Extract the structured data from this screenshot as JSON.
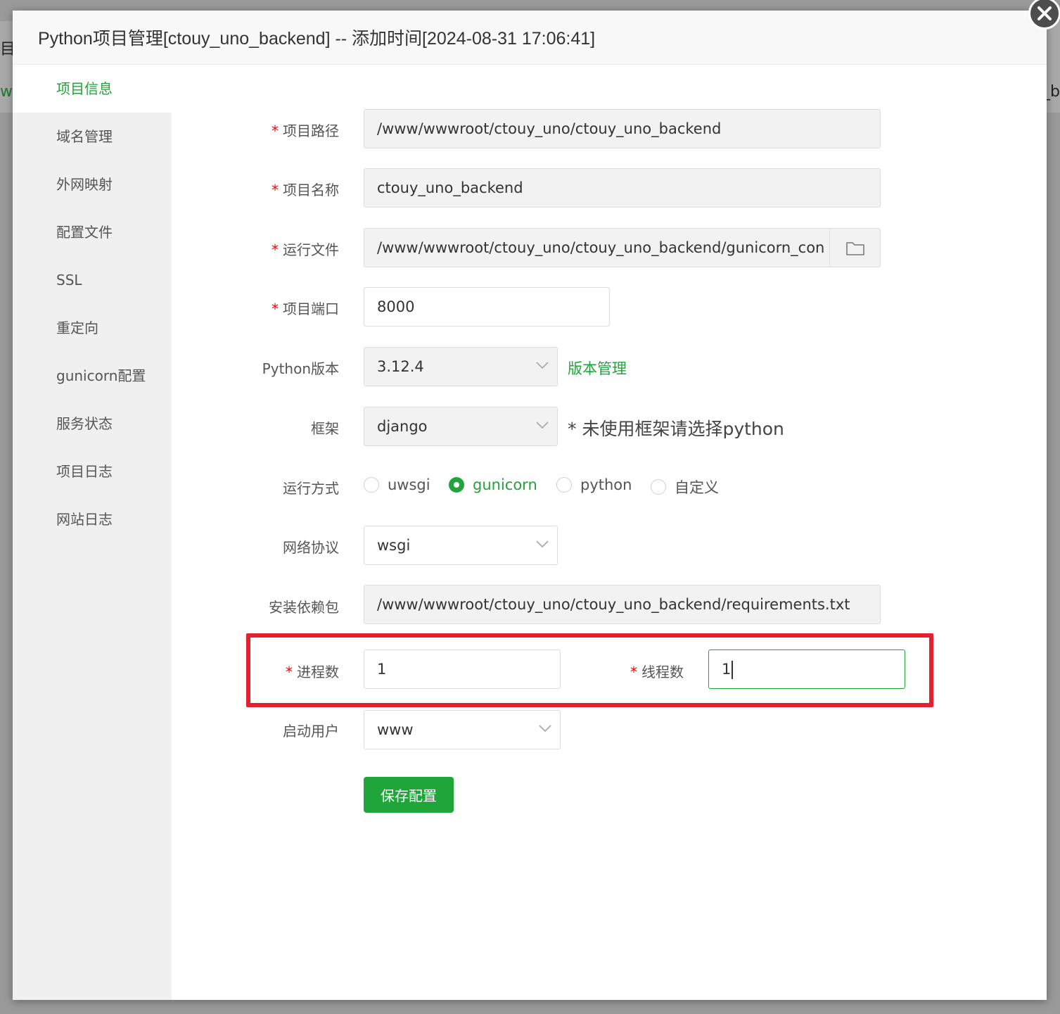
{
  "background": {
    "left_glyph": "目",
    "left_glyph2": "w",
    "right_glyph": "o_b"
  },
  "modal": {
    "title": "Python项目管理[ctouy_uno_backend] -- 添加时间[2024-08-31 17:06:41]"
  },
  "sidebar": {
    "items": [
      {
        "label": "项目信息",
        "active": true
      },
      {
        "label": "域名管理"
      },
      {
        "label": "外网映射"
      },
      {
        "label": "配置文件"
      },
      {
        "label": "SSL"
      },
      {
        "label": "重定向"
      },
      {
        "label": "gunicorn配置"
      },
      {
        "label": "服务状态"
      },
      {
        "label": "项目日志"
      },
      {
        "label": "网站日志"
      }
    ]
  },
  "form": {
    "required_mark": "*",
    "project_path": {
      "label": "项目路径",
      "value": "/www/wwwroot/ctouy_uno/ctouy_uno_backend"
    },
    "project_name": {
      "label": "项目名称",
      "value": "ctouy_uno_backend"
    },
    "run_file": {
      "label": "运行文件",
      "value": "/www/wwwroot/ctouy_uno/ctouy_uno_backend/gunicorn_con"
    },
    "project_port": {
      "label": "项目端口",
      "value": "8000"
    },
    "python_version": {
      "label": "Python版本",
      "value": "3.12.4",
      "link": "版本管理"
    },
    "framework": {
      "label": "框架",
      "value": "django",
      "hint": "* 未使用框架请选择python"
    },
    "run_mode": {
      "label": "运行方式",
      "options": [
        "uwsgi",
        "gunicorn",
        "python",
        "自定义"
      ],
      "selected": "gunicorn"
    },
    "network_protocol": {
      "label": "网络协议",
      "value": "wsgi"
    },
    "requirements": {
      "label": "安装依赖包",
      "value": "/www/wwwroot/ctouy_uno/ctouy_uno_backend/requirements.txt"
    },
    "processes": {
      "label": "进程数",
      "value": "1"
    },
    "threads": {
      "label": "线程数",
      "value": "1"
    },
    "start_user": {
      "label": "启动用户",
      "value": "www"
    },
    "save_label": "保存配置"
  },
  "colors": {
    "accent": "#20a53a",
    "highlight": "#e5202e",
    "required": "#ef0808"
  }
}
